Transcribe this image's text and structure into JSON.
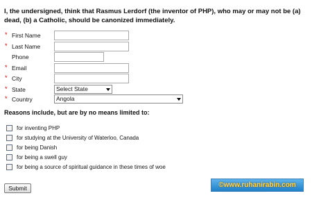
{
  "heading": "I, the undersigned, think that Rasmus Lerdorf (the inventor of PHP), who may or may not be (a) dead, (b) a Catholic, should be canonized immediately.",
  "required_mark": "*",
  "fields": {
    "first_name": {
      "label": "First Name",
      "value": ""
    },
    "last_name": {
      "label": "Last Name",
      "value": ""
    },
    "phone": {
      "label": "Phone",
      "value": ""
    },
    "email": {
      "label": "Email",
      "value": ""
    },
    "city": {
      "label": "City",
      "value": ""
    },
    "state": {
      "label": "State",
      "selected": "Select State"
    },
    "country": {
      "label": "Country",
      "selected": "Angola"
    }
  },
  "reasons": {
    "title": "Reasons include, but are by no means limited to:",
    "items": [
      {
        "label": "for inventing PHP",
        "checked": false
      },
      {
        "label": "for studying at the University of Waterloo, Canada",
        "checked": false
      },
      {
        "label": "for being Danish",
        "checked": false
      },
      {
        "label": "for being a swell guy",
        "checked": false
      },
      {
        "label": "for being a source of spiritual guidance in these times of woe",
        "checked": false
      }
    ]
  },
  "submit_label": "Submit",
  "watermark": "©www.ruhanirabin.com"
}
